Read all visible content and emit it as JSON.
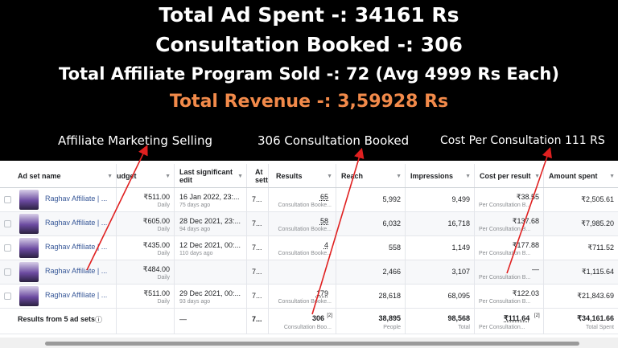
{
  "headlines": {
    "ad_spent": "Total Ad Spent -: 34161 Rs",
    "consultation": "Consultation Booked -: 306",
    "affiliate": "Total Affiliate Program Sold -: 72 (Avg 4999 Rs Each)",
    "revenue": "Total Revenue -: 3,59928 Rs"
  },
  "callouts": {
    "left": "Affiliate Marketing  Selling",
    "middle": "306 Consultation Booked",
    "right": "Cost Per Consultation 111 RS"
  },
  "colors": {
    "revenue": "#f28a4a",
    "link": "#385898",
    "arrow": "#e02020"
  },
  "table": {
    "headers": {
      "ad_set_name": "Ad set name",
      "budget": "udget",
      "last_edit": "Last significant edit",
      "attribution": "At sett",
      "results": "Results",
      "reach": "Reach",
      "impressions": "Impressions",
      "cost_per_result": "Cost per result",
      "amount_spent": "Amount spent"
    },
    "rows": [
      {
        "name": "Raghav Affiliate | ...",
        "budget": "₹511.00",
        "budget_sub": "Daily",
        "edit": "16 Jan 2022, 23:...",
        "edit_sub": "75 days ago",
        "attr": "7...",
        "results": "65",
        "results_sub": "Consultation Booke...",
        "reach": "5,992",
        "impressions": "9,499",
        "cpr": "₹38.55",
        "cpr_sub": "Per Consultation B...",
        "spent": "₹2,505.61"
      },
      {
        "name": "Raghav Affiliate | ...",
        "budget": "₹605.00",
        "budget_sub": "Daily",
        "edit": "28 Dec 2021, 23:...",
        "edit_sub": "94 days ago",
        "attr": "7...",
        "results": "58",
        "results_sub": "Consultation Booke...",
        "reach": "6,032",
        "impressions": "16,718",
        "cpr": "₹137.68",
        "cpr_sub": "Per Consultation B...",
        "spent": "₹7,985.20"
      },
      {
        "name": "Raghav Affiliate | ...",
        "budget": "₹435.00",
        "budget_sub": "Daily",
        "edit": "12 Dec 2021, 00:...",
        "edit_sub": "110 days ago",
        "attr": "7...",
        "results": "4",
        "results_sub": "Consultation Booke...",
        "reach": "558",
        "impressions": "1,149",
        "cpr": "₹177.88",
        "cpr_sub": "Per Consultation B...",
        "spent": "₹711.52"
      },
      {
        "name": "Raghav Affiliate | ...",
        "budget": "₹484.00",
        "budget_sub": "Daily",
        "edit": "",
        "edit_sub": "",
        "attr": "7...",
        "results": "",
        "results_sub": "",
        "reach": "2,466",
        "impressions": "3,107",
        "cpr": "—",
        "cpr_sub": "Per Consultation B...",
        "spent": "₹1,115.64"
      },
      {
        "name": "Raghav Affiliate | ...",
        "budget": "₹511.00",
        "budget_sub": "Daily",
        "edit": "29 Dec 2021, 00:...",
        "edit_sub": "93 days ago",
        "attr": "7...",
        "results": "179",
        "results_sub": "Consultation Booke...",
        "reach": "28,618",
        "impressions": "68,095",
        "cpr": "₹122.03",
        "cpr_sub": "Per Consultation B...",
        "spent": "₹21,843.69"
      }
    ],
    "totals": {
      "label": "Results from 5 ad sets",
      "info_icon": "info-icon",
      "edit": "—",
      "attr": "7...",
      "results": "306",
      "results_badge": "[2]",
      "results_sub": "Consultation Boo...",
      "reach": "38,895",
      "reach_sub": "People",
      "impressions": "98,568",
      "impressions_sub": "Total",
      "cpr": "₹111.64",
      "cpr_badge": "[2]",
      "cpr_sub": "Per Consultation...",
      "spent": "₹34,161.66",
      "spent_sub": "Total Spent"
    }
  }
}
